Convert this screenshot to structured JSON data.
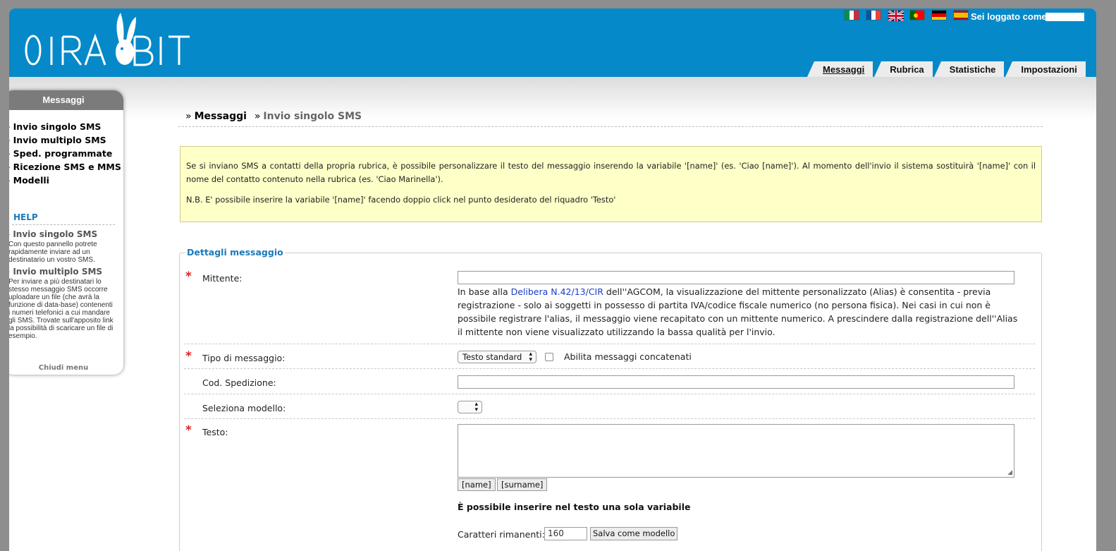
{
  "header": {
    "logo_text": "01RABBIT",
    "logged_in_label": "Sei loggato come:",
    "languages": [
      {
        "name": "italiano",
        "colors": [
          "#009246",
          "#ffffff",
          "#ce2b37"
        ]
      },
      {
        "name": "français",
        "colors": [
          "#0055a4",
          "#ffffff",
          "#ef4135"
        ]
      },
      {
        "name": "english",
        "colors": [
          "#012169",
          "#ffffff",
          "#c8102e"
        ]
      },
      {
        "name": "português",
        "colors": [
          "#006600",
          "#ff0000",
          "#ff0000"
        ]
      },
      {
        "name": "deutsch",
        "colors": [
          "#000000",
          "#dd0000",
          "#ffce00"
        ]
      },
      {
        "name": "español",
        "colors": [
          "#aa151b",
          "#f1bf00",
          "#aa151b"
        ]
      }
    ],
    "tabs": [
      {
        "label": "Messaggi",
        "active": true
      },
      {
        "label": "Rubrica",
        "active": false
      },
      {
        "label": "Statistiche",
        "active": false
      },
      {
        "label": "Impostazioni",
        "active": false
      }
    ]
  },
  "sidebar": {
    "title": "Messaggi",
    "bullet": "»",
    "items": [
      "Invio singolo SMS",
      "Invio multiplo SMS",
      "Sped. programmate",
      "Ricezione SMS e MMS",
      "Modelli"
    ],
    "help_title": "HELP",
    "help": [
      {
        "title": "Invio singolo SMS",
        "text": "Con questo pannello potrete rapidamente inviare ad un destinatario un vostro SMS."
      },
      {
        "title": "Invio multiplo SMS",
        "text": "Per inviare a più destinatari lo stesso messaggio SMS occorre uploadare un file (che avrà la funzione di data-base) contenenti i numeri telefonici a cui mandare gli SMS. Trovate sull'apposito link la possibilità di scaricare un file di esempio."
      }
    ],
    "close_label": "Chiudi menu"
  },
  "breadcrumb": {
    "sep": "»",
    "items": [
      "Messaggi",
      "Invio singolo SMS"
    ]
  },
  "notice": {
    "p1": "Se si inviano SMS a contatti della propria rubrica, è possibile personalizzare il testo del messaggio inserendo la variabile '[name]' (es. 'Ciao [name]'). Al momento dell'invio il sistema sostituirà '[name]' con il nome del contatto contenuto nella rubrica (es. 'Ciao Marinella').",
    "p2": "N.B. E' possibile inserire la variabile '[name]' facendo doppio click nel punto desiderato del riquadro 'Testo'"
  },
  "form": {
    "legend": "Dettagli messaggio",
    "required_mark": "*",
    "mittente": {
      "label": "Mittente:",
      "value": "",
      "info_before": "In base alla",
      "info_link": "Delibera N.42/13/CIR",
      "info_after": "dell''AGCOM, la visualizzazione del mittente personalizzato (Alias) è consentita - previa registrazione - solo ai soggetti in possesso di partita IVA/codice fiscale numerico (no persona fisica). Nei casi in cui non è possibile registrare l'alias, il messaggio viene recapitato con un mittente numerico. A prescindere dalla registrazione dell''Alias il mittente non viene visualizzato utilizzando la bassa qualità per l'invio."
    },
    "tipo": {
      "label": "Tipo di messaggio:",
      "selected": "Testo standard",
      "concat_label": "Abilita messaggi concatenati",
      "concat_checked": false
    },
    "cod_spedizione": {
      "label": "Cod. Spedizione:",
      "value": ""
    },
    "modello": {
      "label": "Seleziona modello:",
      "selected": ""
    },
    "testo": {
      "label": "Testo:",
      "value": "",
      "var_buttons": [
        "[name]",
        "[surname]"
      ],
      "one_var_note": "È possibile inserire nel testo una sola variabile",
      "chars_label": "Caratteri rimanenti:",
      "chars_value": "160",
      "save_label": "Salva come modello"
    }
  }
}
